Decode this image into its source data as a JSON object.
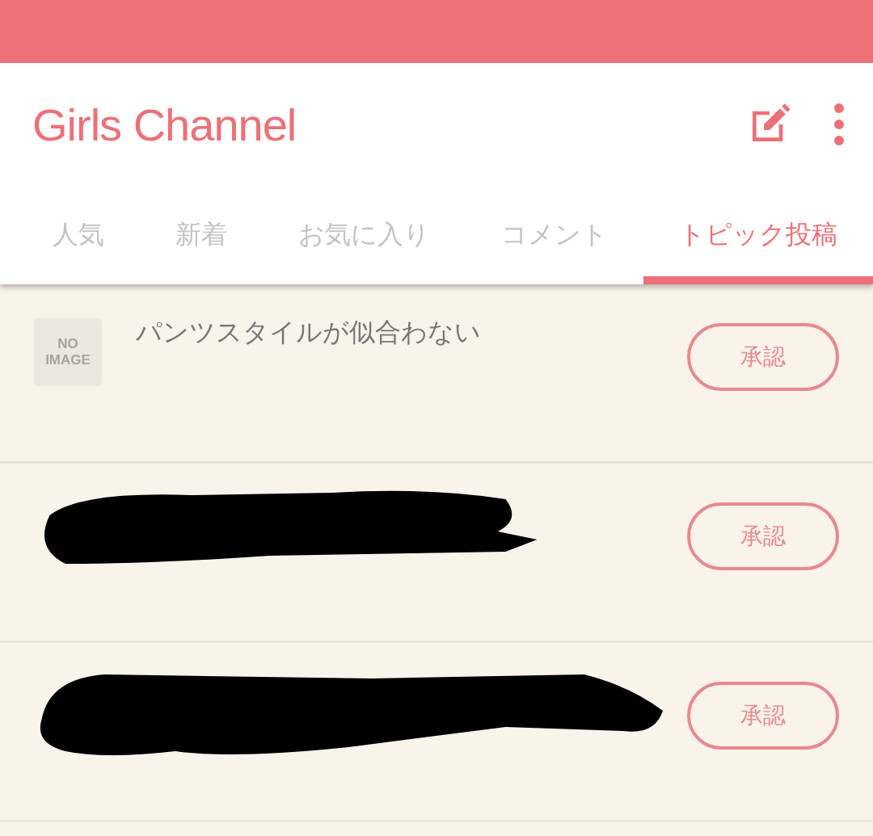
{
  "app_bar": {
    "title": "Girls Channel"
  },
  "tabs": [
    {
      "label": "人気",
      "selected": false
    },
    {
      "label": "新着",
      "selected": false
    },
    {
      "label": "お気に入り",
      "selected": false
    },
    {
      "label": "コメント",
      "selected": false
    },
    {
      "label": "トピック投稿",
      "selected": true
    }
  ],
  "topics": [
    {
      "kind": "topic",
      "thumbnail": {
        "line_1": "NO",
        "line_2": "IMAGE"
      },
      "title": "パンツスタイルが似合わない",
      "button": "承認"
    },
    {
      "kind": "redacted",
      "button": "承認"
    },
    {
      "kind": "redacted",
      "button": "承認"
    }
  ]
}
